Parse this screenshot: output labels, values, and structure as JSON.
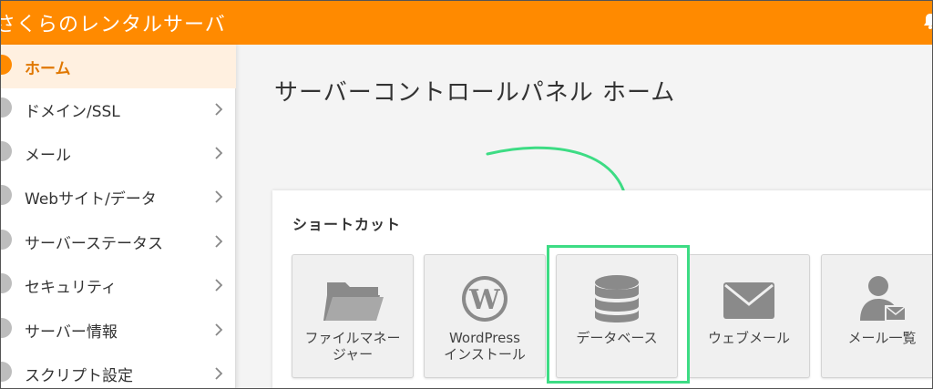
{
  "header": {
    "app_title": "さくらのレンタルサーバ",
    "accent_color": "#ff8a00",
    "bell_icon": "bell-icon"
  },
  "sidebar": {
    "items": [
      {
        "label": "ホーム",
        "active": true,
        "icon": "home-icon"
      },
      {
        "label": "ドメイン/SSL",
        "icon": "domain-icon"
      },
      {
        "label": "メール",
        "icon": "mail-icon"
      },
      {
        "label": "Webサイト/データ",
        "icon": "web-icon"
      },
      {
        "label": "サーバーステータス",
        "icon": "status-icon"
      },
      {
        "label": "セキュリティ",
        "icon": "security-icon"
      },
      {
        "label": "サーバー情報",
        "icon": "server-info-icon"
      },
      {
        "label": "スクリプト設定",
        "icon": "script-icon"
      }
    ]
  },
  "main": {
    "page_title": "サーバーコントロールパネル ホーム",
    "shortcuts": {
      "title": "ショートカット",
      "tiles": [
        {
          "label_line1": "ファイルマネー",
          "label_line2": "ジャー",
          "icon": "folder-icon"
        },
        {
          "label_line1": "WordPress",
          "label_line2": "インストール",
          "icon": "wordpress-icon"
        },
        {
          "label_line1": "データベース",
          "label_line2": "",
          "icon": "database-icon",
          "highlighted": true
        },
        {
          "label_line1": "ウェブメール",
          "label_line2": "",
          "icon": "envelope-icon"
        },
        {
          "label_line1": "メール一覧",
          "label_line2": "",
          "icon": "mail-user-icon"
        }
      ]
    },
    "highlight_color": "#3ddc84"
  }
}
